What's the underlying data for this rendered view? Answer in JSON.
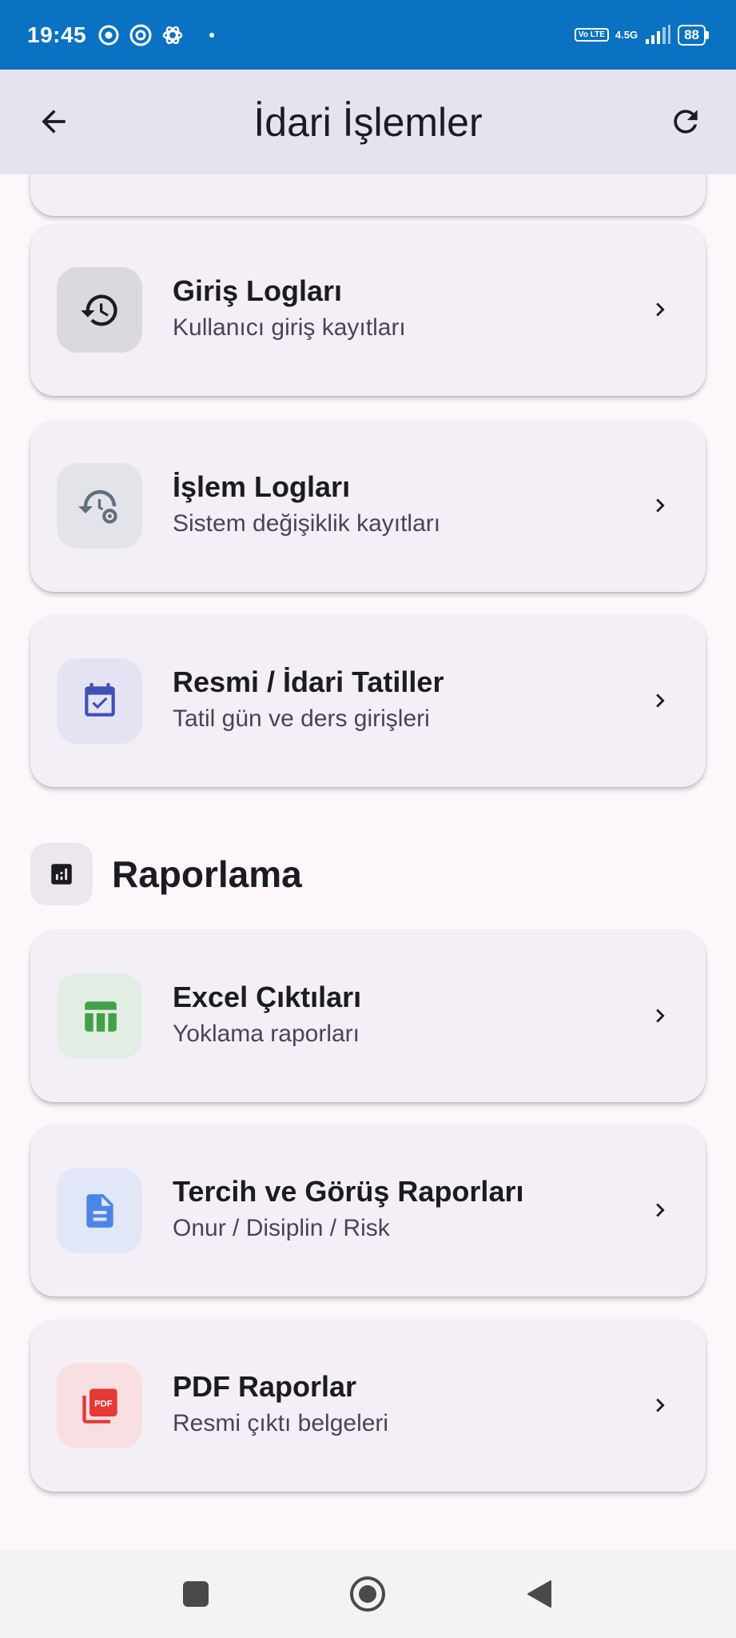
{
  "status_bar": {
    "time": "19:45",
    "volte": "Vo LTE",
    "network": "4.5G",
    "battery": "88"
  },
  "app_bar": {
    "title": "İdari İşlemler",
    "back_icon": "arrow-back-icon",
    "refresh_icon": "refresh-icon"
  },
  "cards": [
    {
      "title": "Giriş Logları",
      "subtitle": "Kullanıcı giriş kayıtları",
      "icon": "history-icon",
      "icon_color": "#1c1b1f",
      "icon_bg": "#dcd9de"
    },
    {
      "title": "İşlem Logları",
      "subtitle": "Sistem değişiklik kayıtları",
      "icon": "history-settings-icon",
      "icon_color": "#5f6f7d",
      "icon_bg": "#e3e4e9"
    },
    {
      "title": "Resmi / İdari Tatiller",
      "subtitle": "Tatil gün ve ders girişleri",
      "icon": "calendar-check-icon",
      "icon_color": "#3f51b5",
      "icon_bg": "#e3e3f3"
    }
  ],
  "section": {
    "title": "Raporlama",
    "icon": "bar-chart-icon"
  },
  "report_cards": [
    {
      "title": "Excel Çıktıları",
      "subtitle": "Yoklama raporları",
      "icon": "table-icon",
      "icon_color": "#43a047",
      "icon_bg": "#e2ede3"
    },
    {
      "title": "Tercih ve Görüş Raporları",
      "subtitle": "Onur / Disiplin / Risk",
      "icon": "document-icon",
      "icon_color": "#4a86e8",
      "icon_bg": "#e1e7f7"
    },
    {
      "title": "PDF Raporlar",
      "subtitle": "Resmi çıktı belgeleri",
      "icon": "pdf-icon",
      "icon_color": "#e53935",
      "icon_bg": "#f7dfe2"
    }
  ],
  "nav": {
    "recents_icon": "square-recents-icon",
    "home_icon": "circle-home-icon",
    "back_icon": "triangle-back-icon"
  }
}
